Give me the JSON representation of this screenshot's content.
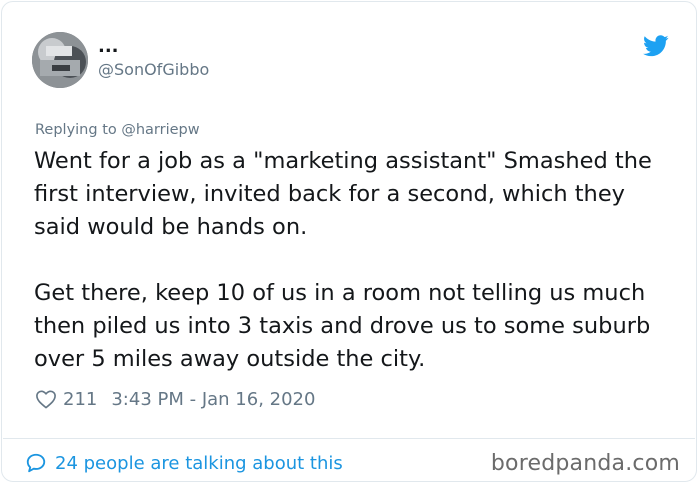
{
  "tweet": {
    "display_name": "...",
    "handle": "@SonOfGibbo",
    "replying_to": "Replying to @harriepw",
    "paragraphs": [
      "Went for a job as a  \"marketing assistant\" Smashed the first interview, invited back for a second, which they said would be hands on.",
      "Get there, keep 10 of us in a room not telling us much then piled us into 3 taxis and drove us to some suburb over 5 miles away outside the city."
    ],
    "likes": "211",
    "timestamp": "3:43 PM - Jan 16, 2020",
    "talking": "24 people are talking about this"
  },
  "watermark": "boredpanda.com",
  "colors": {
    "twitter_blue": "#1da1f2",
    "link_blue": "#1b95e0",
    "secondary_text": "#657786",
    "border": "#e1e8ed"
  },
  "icons": {
    "brand": "twitter-bird-icon",
    "likes": "heart-icon",
    "talking": "speech-bubble-icon"
  }
}
